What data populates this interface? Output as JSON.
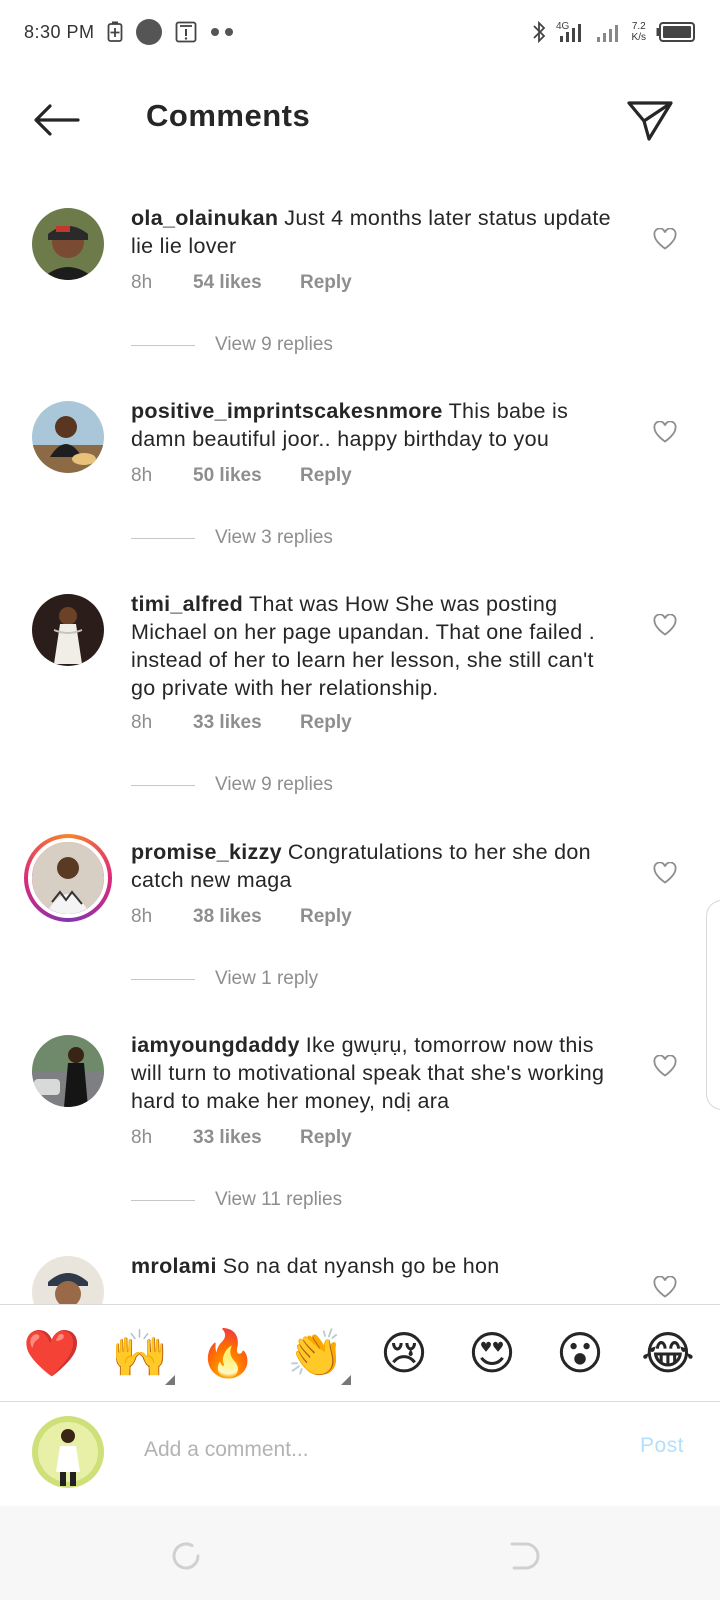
{
  "status_bar": {
    "time": "8:30 PM",
    "network": "4G",
    "speed_value": "7.2",
    "speed_unit": "K/s"
  },
  "header": {
    "title": "Comments",
    "back_icon": "arrow-left-icon",
    "send_icon": "paper-plane-icon"
  },
  "comments": [
    {
      "username": "ola_olainukan",
      "text": "Just 4 months later status update lie lie lover",
      "time": "8h",
      "likes": "54 likes",
      "reply": "Reply",
      "view_replies": "View 9 replies"
    },
    {
      "username": "positive_imprintscakesnmore",
      "text": "This babe is damn beautiful joor.. happy birthday to you",
      "time": "8h",
      "likes": "50 likes",
      "reply": "Reply",
      "view_replies": "View 3 replies"
    },
    {
      "username": "timi_alfred",
      "text": "That was How She was posting Michael on her page upandan. That one failed . instead of her to learn her lesson, she still can't go private with her relationship.",
      "time": "8h",
      "likes": "33 likes",
      "reply": "Reply",
      "view_replies": "View 9 replies"
    },
    {
      "username": "promise_kizzy",
      "text": "Congratulations to her she don catch new maga",
      "time": "8h",
      "likes": "38 likes",
      "reply": "Reply",
      "view_replies": "View 1 reply"
    },
    {
      "username": "iamyoungdaddy",
      "text": "Ike gwụrụ, tomorrow now this will turn to motivational speak that she's working hard to make her money, ndị ara",
      "time": "8h",
      "likes": "33 likes",
      "reply": "Reply",
      "view_replies": "View 11 replies"
    },
    {
      "username": "mrolami",
      "text": "So na dat nyansh go be hon"
    }
  ],
  "emoji_bar": [
    "❤️",
    "🙌",
    "🔥",
    "👏",
    "😢",
    "😍",
    "😮",
    "😂"
  ],
  "input": {
    "placeholder": "Add a comment...",
    "post_label": "Post"
  },
  "colors": {
    "text": "#262626",
    "secondary": "#8e8e8e",
    "post_disabled": "#b2dffc",
    "divider": "#dbdbdb"
  }
}
